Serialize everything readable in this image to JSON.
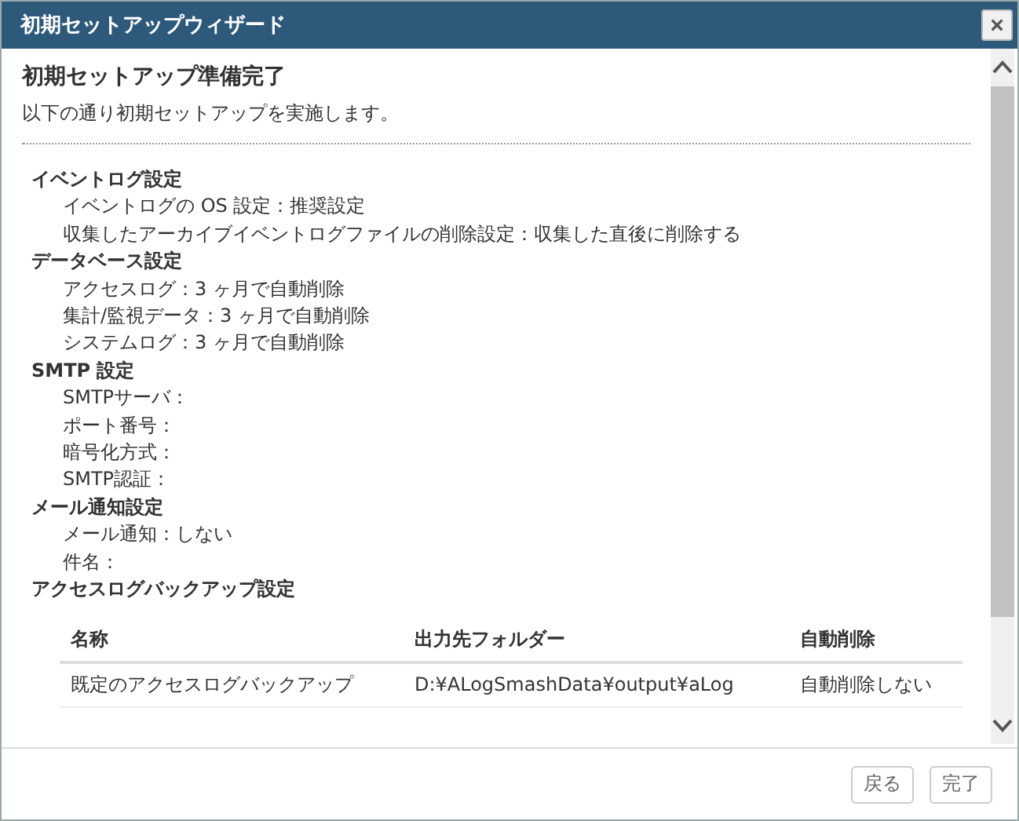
{
  "window": {
    "title": "初期セットアップウィザード",
    "close": "×"
  },
  "heading": "初期セットアップ準備完了",
  "description": "以下の通り初期セットアップを実施します。",
  "sections": [
    {
      "title": "イベントログ設定",
      "items": [
        "イベントログの OS 設定：推奨設定",
        "収集したアーカイブイベントログファイルの削除設定：収集した直後に削除する"
      ]
    },
    {
      "title": "データベース設定",
      "items": [
        "アクセスログ：3 ヶ月で自動削除",
        "集計/監視データ：3 ヶ月で自動削除",
        "システムログ：3 ヶ月で自動削除"
      ]
    },
    {
      "title": "SMTP 設定",
      "items": [
        "SMTPサーバ：",
        "ポート番号：",
        "暗号化方式：",
        "SMTP認証："
      ]
    },
    {
      "title": "メール通知設定",
      "items": [
        "メール通知：しない",
        "件名："
      ]
    },
    {
      "title": "アクセスログバックアップ設定"
    }
  ],
  "table": {
    "columns": [
      "名称",
      "出力先フォルダー",
      "自動削除"
    ],
    "rows": [
      [
        "既定のアクセスログバックアップ",
        "D:¥ALogSmashData¥output¥aLog",
        "自動削除しない"
      ]
    ]
  },
  "buttons": [
    "戻る",
    "完了"
  ]
}
